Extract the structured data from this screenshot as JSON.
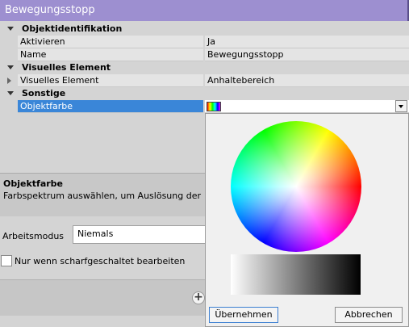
{
  "window": {
    "title": "Bewegungsstopp"
  },
  "properties": {
    "cat1": "Objektidentifikation",
    "activate_label": "Aktivieren",
    "activate_value": "Ja",
    "name_label": "Name",
    "name_value": "Bewegungsstopp",
    "cat2": "Visuelles Element",
    "visual_label": "Visuelles Element",
    "visual_value": "Anhaltebereich",
    "cat3": "Sonstige",
    "color_label": "Objektfarbe"
  },
  "description": {
    "title": "Objektfarbe",
    "text": "Farbspektrum auswählen, um Auslösung der"
  },
  "mode": {
    "label": "Arbeitsmodus",
    "value": "Niemals"
  },
  "checkbox": {
    "label": "Nur wenn scharfgeschaltet bearbeiten",
    "checked": false
  },
  "color_picker": {
    "apply": "Übernehmen",
    "cancel": "Abbrechen"
  },
  "icons": {
    "expanded": "triangle-down-icon",
    "collapsed": "triangle-right-icon",
    "add": "plus-icon",
    "dropdown": "chevron-down-icon"
  }
}
